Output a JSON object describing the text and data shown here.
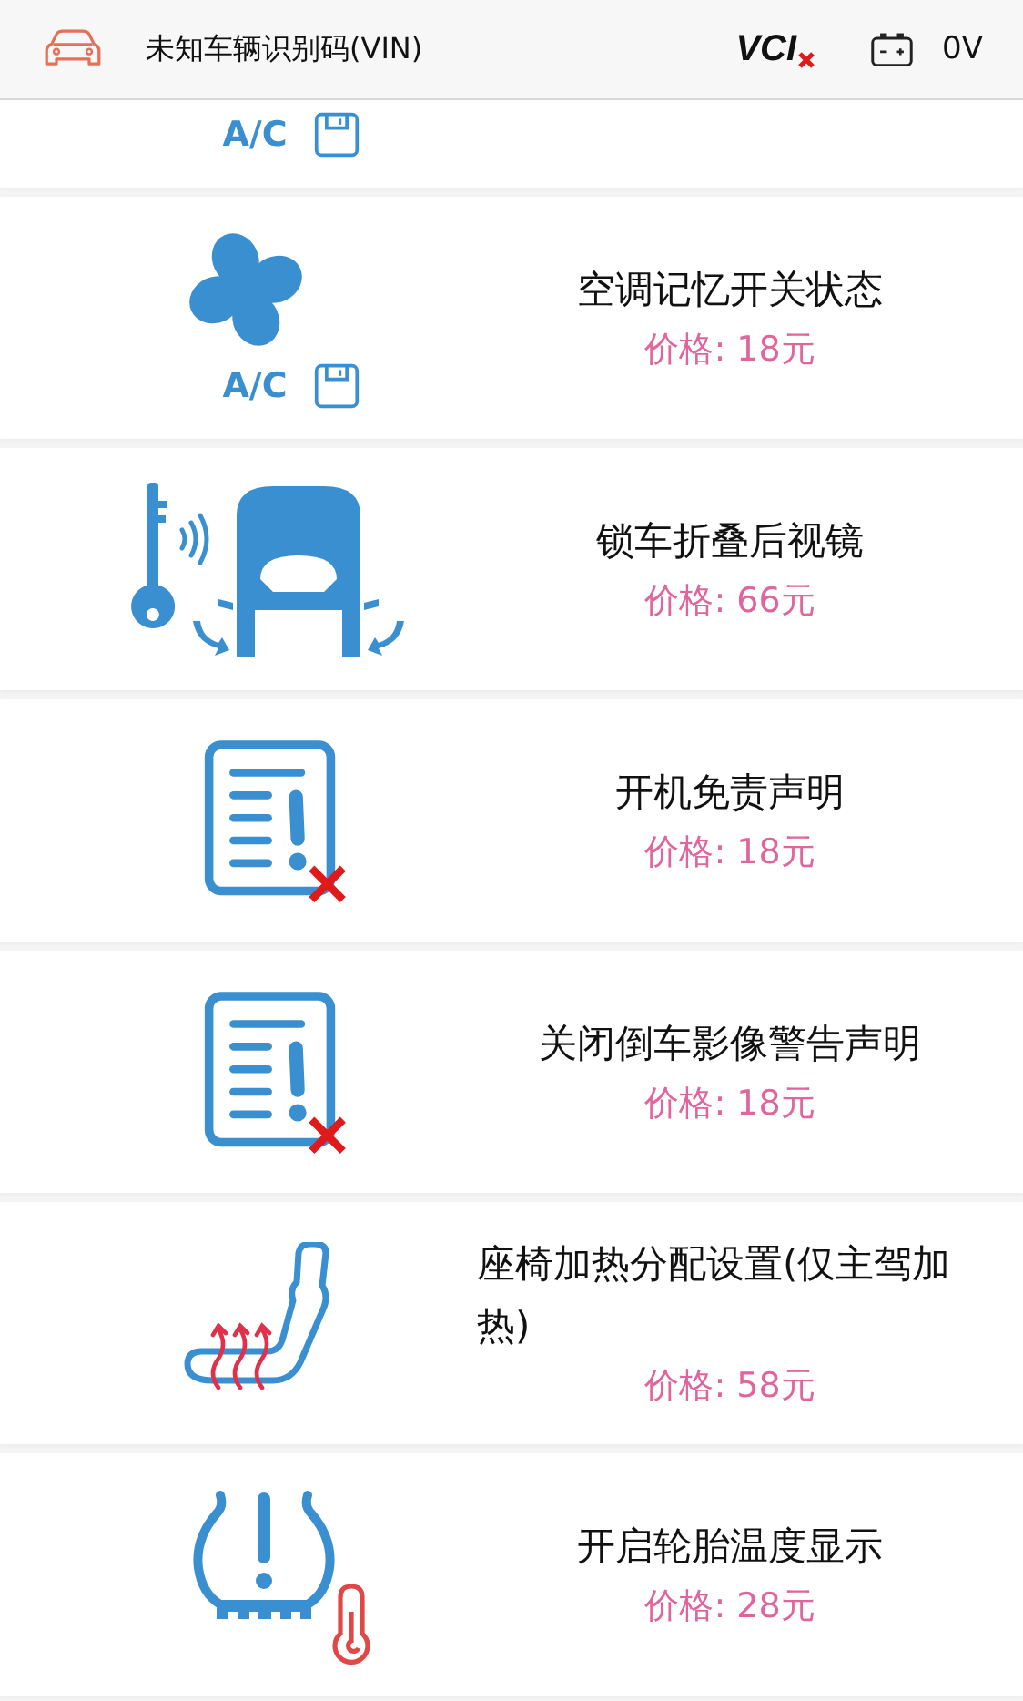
{
  "header": {
    "title": "未知车辆识别码(VIN)",
    "vci": "VCI",
    "vci_connected": false,
    "voltage": "0V"
  },
  "items": [
    {
      "kind": "ac-label",
      "icon_label": "A/C"
    },
    {
      "kind": "ac-memory",
      "icon_label": "A/C",
      "title": "空调记忆开关状态",
      "price": "价格: 18元"
    },
    {
      "kind": "mirror",
      "title": "锁车折叠后视镜",
      "price": "价格: 66元"
    },
    {
      "kind": "doc-warning",
      "title": "开机免责声明",
      "price": "价格: 18元"
    },
    {
      "kind": "doc-warning",
      "title": "关闭倒车影像警告声明",
      "price": "价格: 18元"
    },
    {
      "kind": "seat-heat",
      "title": "座椅加热分配设置(仅主驾加热)",
      "price": "价格: 58元"
    },
    {
      "kind": "tire-temp",
      "title": "开启轮胎温度显示",
      "price": "价格: 28元"
    }
  ]
}
